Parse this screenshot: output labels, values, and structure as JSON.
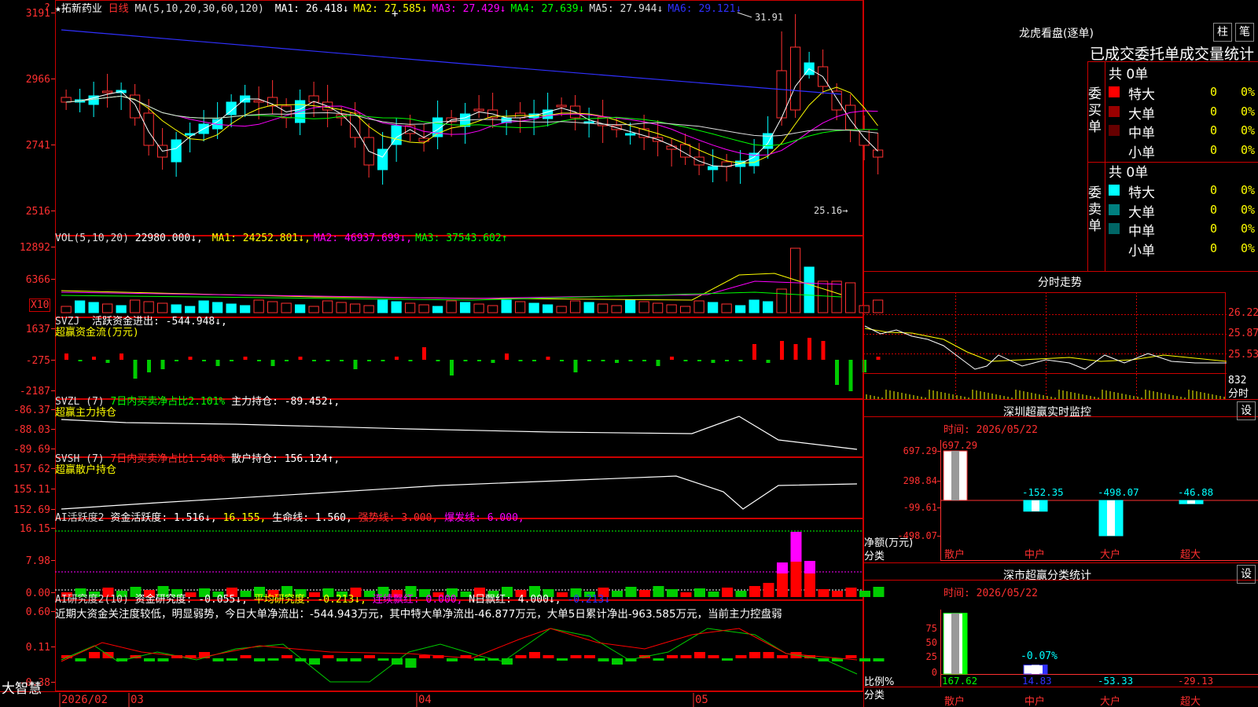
{
  "stock": {
    "name": "★拓新药业",
    "period": "日线",
    "ma_label": "MA(5,10,20,30,60,120)",
    "ma": [
      {
        "label": "MA1:",
        "value": "26.418",
        "arrow": "↓",
        "color": "#ffffff"
      },
      {
        "label": "MA2:",
        "value": "27.585",
        "arrow": "↓",
        "color": "#ffff00"
      },
      {
        "label": "MA3:",
        "value": "27.429",
        "arrow": "↓",
        "color": "#ff00ff"
      },
      {
        "label": "MA4:",
        "value": "27.639",
        "arrow": "↓",
        "color": "#00ff00"
      },
      {
        "label": "MA5:",
        "value": "27.944",
        "arrow": "↓",
        "color": "#dddddd"
      },
      {
        "label": "MA6:",
        "value": "29.121",
        "arrow": "↓",
        "color": "#3030ff"
      }
    ],
    "price_ticks": [
      "3191",
      "2966",
      "2741",
      "2516"
    ],
    "high_label": "31.91",
    "low_label": "25.16→",
    "price_dots": "·"
  },
  "vol": {
    "label": "VOL(5,10,20)",
    "value": "22980.000↓,",
    "ma": [
      {
        "label": "MA1:",
        "value": "24252.801↓,",
        "color": "#ffff00"
      },
      {
        "label": "MA2:",
        "value": "46937.699↓,",
        "color": "#ff00ff"
      },
      {
        "label": "MA3:",
        "value": "37543.602↑",
        "color": "#00ff00"
      }
    ],
    "ticks": [
      "12892",
      "6366"
    ],
    "unit": "X10"
  },
  "svzj": {
    "label": "SVZJ",
    "text": "活跃资金进出: -544.948↓,",
    "sub": "超赢资金流(万元)",
    "ticks": [
      "1637",
      "-275",
      "-2187"
    ]
  },
  "svzl": {
    "label": "SVZL (7)",
    "text1": "7日内买卖净占比2.101%",
    "text2": "主力持仓: -89.452↓,",
    "sub": "超赢主力持仓",
    "ticks": [
      "-86.37",
      "-88.03",
      "-89.69"
    ]
  },
  "svsh": {
    "label": "SVSH (7)",
    "text1": "7日内买卖净占比1.548%",
    "text2": "散户持仓: 156.124↑,",
    "sub": "超赢散户持仓",
    "ticks": [
      "157.62",
      "155.11",
      "152.69"
    ]
  },
  "ai_active": {
    "label": "AI活跃度2",
    "text1": "资金活跃度: 1.516↓,",
    "text2": "16.155,",
    "text3": "生命线: 1.560,",
    "text4": "强势线: 3.000,",
    "text5": "爆发线: 6.000,",
    "ticks": [
      "16.15",
      "7.98",
      "0.00"
    ]
  },
  "ai_research": {
    "label": "AI研究度2(10)",
    "text1": "资金研究度: -0.055↓,",
    "text2": "平均研究度: -0.213↓,",
    "text3": "连续飘红: 0.000,",
    "text4": "N日飘红: 4.000↓,",
    "text5": "-0.213↓",
    "comment": "近期大资金关注度较低，明显弱势，今日大单净流出：-544.943万元，其中特大单净流出-46.877万元，大单5日累计净出-963.585万元，当前主力控盘弱",
    "ticks": [
      "0.60",
      "0.11",
      "-0.38"
    ]
  },
  "bottom_axis": {
    "brand": "大智慧",
    "dates": [
      "2026/02",
      "03",
      "04",
      "05"
    ]
  },
  "dragon": {
    "title": "龙虎看盘(逐单)",
    "btn1": "柱",
    "btn2": "笔",
    "stat_title": "已成交委托单成交量统计",
    "buy_label": "委买单",
    "sell_label": "委卖单",
    "buy_total": "共 0单",
    "sell_total": "共 0单",
    "buy_rows": [
      {
        "name": "特大",
        "n": "0",
        "p": "0%",
        "color": "#ff0000"
      },
      {
        "name": "大单",
        "n": "0",
        "p": "0%",
        "color": "#990000"
      },
      {
        "name": "中单",
        "n": "0",
        "p": "0%",
        "color": "#660000"
      },
      {
        "name": "小单",
        "n": "0",
        "p": "0%",
        "color": ""
      }
    ],
    "sell_rows": [
      {
        "name": "特大",
        "n": "0",
        "p": "0%",
        "color": "#00ffff"
      },
      {
        "name": "大单",
        "n": "0",
        "p": "0%",
        "color": "#008080"
      },
      {
        "name": "中单",
        "n": "0",
        "p": "0%",
        "color": "#006666"
      },
      {
        "name": "小单",
        "n": "0",
        "p": "0%",
        "color": ""
      }
    ]
  },
  "intraday": {
    "title": "分时走势",
    "ticks": [
      "26.22",
      "25.87",
      "25.53"
    ],
    "vol_tick": "832",
    "unit": "分时"
  },
  "sz_monitor": {
    "title": "深圳超赢实时监控",
    "btn": "设",
    "time": "时间: 2026/05/22",
    "ticks": [
      "697.29",
      "298.84",
      "-99.61",
      "-498.07"
    ],
    "ylabel": "净额(万元)",
    "xlabel": "分类",
    "bars": [
      {
        "cat": "散户",
        "value": 697.29,
        "label": "697.29",
        "color": "#ff3030"
      },
      {
        "cat": "中户",
        "value": -152.35,
        "label": "-152.35",
        "color": "#00ffff"
      },
      {
        "cat": "大户",
        "value": -498.07,
        "label": "-498.07",
        "color": "#00ffff"
      },
      {
        "cat": "超大",
        "value": -46.88,
        "label": "-46.88",
        "color": "#00ffff"
      }
    ]
  },
  "sz_class": {
    "title": "深市超赢分类统计",
    "btn": "设",
    "time": "时间: 2026/05/22",
    "ticks": [
      "75",
      "50",
      "25",
      "0"
    ],
    "ylabel": "比例%",
    "xlabel": "分类",
    "mid_label": "-0.07%",
    "bars": [
      {
        "cat": "散户",
        "value": 167.62,
        "label": "167.62",
        "color": "#00ff00"
      },
      {
        "cat": "中户",
        "value": 14.83,
        "label": "14.83",
        "color": "#3030ff"
      },
      {
        "cat": "大户",
        "value": -53.33,
        "label": "-53.33",
        "color": "#00ffff"
      },
      {
        "cat": "超大",
        "value": -29.13,
        "label": "-29.13",
        "color": "#ff3030"
      }
    ]
  }
}
